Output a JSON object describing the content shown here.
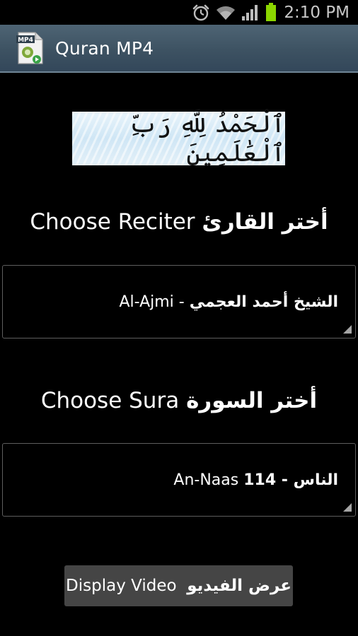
{
  "status_bar": {
    "time": "2:10 PM",
    "icons": [
      "alarm-icon",
      "wifi-icon",
      "signal-icon",
      "battery-icon"
    ],
    "battery_color": "#8bd600"
  },
  "action_bar": {
    "title": "Quran MP4",
    "app_icon_badge": "MP4"
  },
  "banner": {
    "text": "ٱلْحَمْدُ لِلَّهِ رَبِّ ٱلْعَٰلَمِينَ"
  },
  "reciter": {
    "label_en": "Choose Reciter",
    "label_ar": "أختر القارئ",
    "selected_en": "Al-Ajmi -",
    "selected_ar": "الشيخ أحمد العجمي"
  },
  "sura": {
    "label_en": "Choose Sura",
    "label_ar": "أختر السورة",
    "selected_en": "An-Naas",
    "selected_ar": "114 - الناس"
  },
  "display_button": {
    "label_en": "Display Video",
    "label_ar": "عرض الفيديو"
  },
  "colors": {
    "background": "#000000",
    "action_bar": "#3d5262",
    "button": "#454545",
    "spinner_border": "#5e5e5e"
  }
}
